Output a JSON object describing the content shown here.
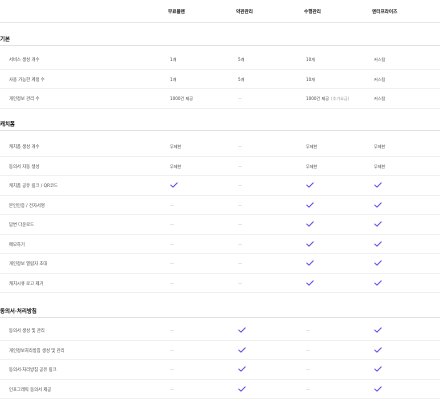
{
  "header": {
    "columns": [
      "무료플랜",
      "약관관리",
      "수행관리",
      "엔터프라이즈"
    ]
  },
  "sections": [
    {
      "title": "기본",
      "rows": [
        {
          "label": "서비스 생성 개수",
          "cells": [
            {
              "text": "1개"
            },
            {
              "text": "5개"
            },
            {
              "text": "10개"
            },
            {
              "text": "커스텀"
            }
          ]
        },
        {
          "label": "사용 가능한 계정 수",
          "cells": [
            {
              "text": "1개"
            },
            {
              "text": "5개"
            },
            {
              "text": "10개"
            },
            {
              "text": "커스텀"
            }
          ]
        },
        {
          "label": "개인정보 관리 수",
          "cells": [
            {
              "text": "1000건 제공"
            },
            {
              "dash": "—"
            },
            {
              "text": "1000건 제공",
              "note": "(추가요금)"
            },
            {
              "text": "커스텀"
            }
          ]
        }
      ]
    },
    {
      "title": "캐치폼",
      "rows": [
        {
          "label": "캐치폼 생성 개수",
          "cells": [
            {
              "text": "무제한"
            },
            {
              "dash": "—"
            },
            {
              "text": "무제한"
            },
            {
              "text": "무제한"
            }
          ]
        },
        {
          "label": "동의서 자동 생성",
          "cells": [
            {
              "text": "무제한"
            },
            {
              "dash": "—"
            },
            {
              "text": "무제한"
            },
            {
              "text": "무제한"
            }
          ]
        },
        {
          "label": "캐치폼 공유 링크 / QR코드",
          "cells": [
            {
              "check": true
            },
            {
              "dash": "—"
            },
            {
              "check": true
            },
            {
              "check": true
            }
          ]
        },
        {
          "label": "본인인증 / 전자서명",
          "cells": [
            {
              "dash": "—"
            },
            {
              "dash": "—"
            },
            {
              "check": true
            },
            {
              "check": true
            }
          ]
        },
        {
          "label": "답변 다운로드",
          "cells": [
            {
              "dash": "—"
            },
            {
              "dash": "—"
            },
            {
              "check": true
            },
            {
              "check": true
            }
          ]
        },
        {
          "label": "메모하기",
          "cells": [
            {
              "dash": "—"
            },
            {
              "dash": "—"
            },
            {
              "check": true
            },
            {
              "check": true
            }
          ]
        },
        {
          "label": "개인정보 열람자 초대",
          "cells": [
            {
              "dash": "—"
            },
            {
              "dash": "—"
            },
            {
              "check": true
            },
            {
              "check": true
            }
          ]
        },
        {
          "label": "캐치시큐 로고 제거",
          "cells": [
            {
              "dash": "—"
            },
            {
              "dash": "—"
            },
            {
              "check": true
            },
            {
              "check": true
            }
          ]
        }
      ]
    },
    {
      "title": "동의서·처리방침",
      "rows": [
        {
          "label": "동의서 생성 및 관리",
          "cells": [
            {
              "dash": "—"
            },
            {
              "check": true
            },
            {
              "dash": "—"
            },
            {
              "check": true
            }
          ]
        },
        {
          "label": "개인정보처리방침 생성 및 관리",
          "cells": [
            {
              "dash": "—"
            },
            {
              "check": true
            },
            {
              "dash": "—"
            },
            {
              "check": true
            }
          ]
        },
        {
          "label": "동의서·처리방침 공유 링크",
          "cells": [
            {
              "dash": "—"
            },
            {
              "check": true
            },
            {
              "dash": "—"
            },
            {
              "check": true
            }
          ]
        },
        {
          "label": "인포그래픽 동의서 제공",
          "cells": [
            {
              "dash": "—"
            },
            {
              "check": true
            },
            {
              "dash": "—"
            },
            {
              "check": true
            }
          ]
        }
      ]
    }
  ],
  "colors": {
    "accent": "#6b4de6",
    "divider": "#e6e6e6"
  },
  "icons": {
    "check": "check-icon"
  }
}
